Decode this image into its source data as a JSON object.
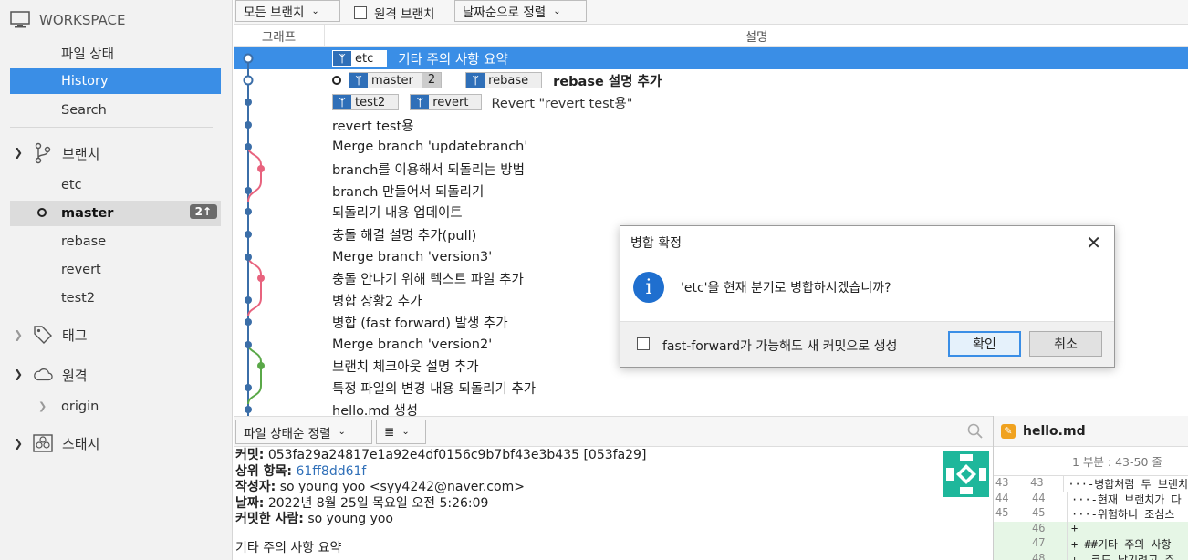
{
  "sidebar": {
    "workspace": "WORKSPACE",
    "items": [
      "파일 상태",
      "History",
      "Search"
    ],
    "branches_label": "브랜치",
    "branches": [
      "etc",
      "master",
      "rebase",
      "revert",
      "test2"
    ],
    "master_badge": "2↑",
    "tags_label": "태그",
    "remotes_label": "원격",
    "remote_origin": "origin",
    "stash_label": "스태시"
  },
  "toolbar": {
    "branch_filter": "모든 브랜치",
    "remote_branch_label": "원격 브랜치",
    "sort": "날짜순으로 정렬"
  },
  "columns": {
    "graph": "그래프",
    "description": "설명"
  },
  "commits": [
    {
      "message": "기타 주의 사항 요약",
      "tags": [
        "etc"
      ]
    },
    {
      "message": "rebase 설명 추가",
      "tags": [
        "master",
        "rebase"
      ],
      "ahead": "2"
    },
    {
      "message": "Revert \"revert test용\"",
      "tags": [
        "test2",
        "revert"
      ]
    },
    {
      "message": "revert test용"
    },
    {
      "message": "Merge branch 'updatebranch'"
    },
    {
      "message": "branch를 이용해서 되돌리는 방법"
    },
    {
      "message": "branch 만들어서 되돌리기"
    },
    {
      "message": "되돌리기 내용 업데이트"
    },
    {
      "message": "충돌 해결 설명 추가(pull)"
    },
    {
      "message": "Merge branch 'version3'"
    },
    {
      "message": "충돌 안나기 위해 텍스트 파일 추가"
    },
    {
      "message": "병합 상황2 추가"
    },
    {
      "message": "병합 (fast forward) 발생 추가"
    },
    {
      "message": "Merge branch 'version2'"
    },
    {
      "message": "브랜치 체크아웃 설명 추가"
    },
    {
      "message": "특정 파일의 변경 내용 되돌리기 추가"
    },
    {
      "message": "hello.md 생성"
    }
  ],
  "bottom_toolbar": {
    "sort": "파일 상태순 정렬",
    "view_icon": "≣"
  },
  "details": {
    "commit_label": "커밋:",
    "commit_value": "053fa29a24817e1a92e4df0156c9b7bf43e3b435 [053fa29]",
    "parent_label": "상위 항목:",
    "parent_value": "61ff8dd61f",
    "author_label": "작성자:",
    "author_value": "so young yoo <syy4242@naver.com>",
    "date_label": "날짜:",
    "date_value": "2022년 8월 25일 목요일 오전 5:26:09",
    "committer_label": "커밋한 사람:",
    "committer_value": "so young yoo",
    "message": "기타 주의 사항 요약"
  },
  "diff": {
    "filename": "hello.md",
    "hunk": "1 부분 : 43-50 줄",
    "lines": [
      {
        "n1": "43",
        "n2": "43",
        "code": "···-병합처럼 두 브랜치"
      },
      {
        "n1": "44",
        "n2": "44",
        "code": "···-현재 브랜치가 다"
      },
      {
        "n1": "45",
        "n2": "45",
        "code": "···-위험하니 조심스"
      },
      {
        "n1": "",
        "n2": "46",
        "code": "+"
      },
      {
        "n1": "",
        "n2": "47",
        "code": "+ ##기타 주의 사항"
      },
      {
        "n1": "",
        "n2": "48",
        "code": "+ -코드 남기려고 주"
      }
    ]
  },
  "dialog": {
    "title": "병합 확정",
    "message": "'etc'을 현재 분기로 병합하시겠습니까?",
    "checkbox_label": "fast-forward가 가능해도 새 커밋으로 생성",
    "ok": "확인",
    "cancel": "취소"
  }
}
